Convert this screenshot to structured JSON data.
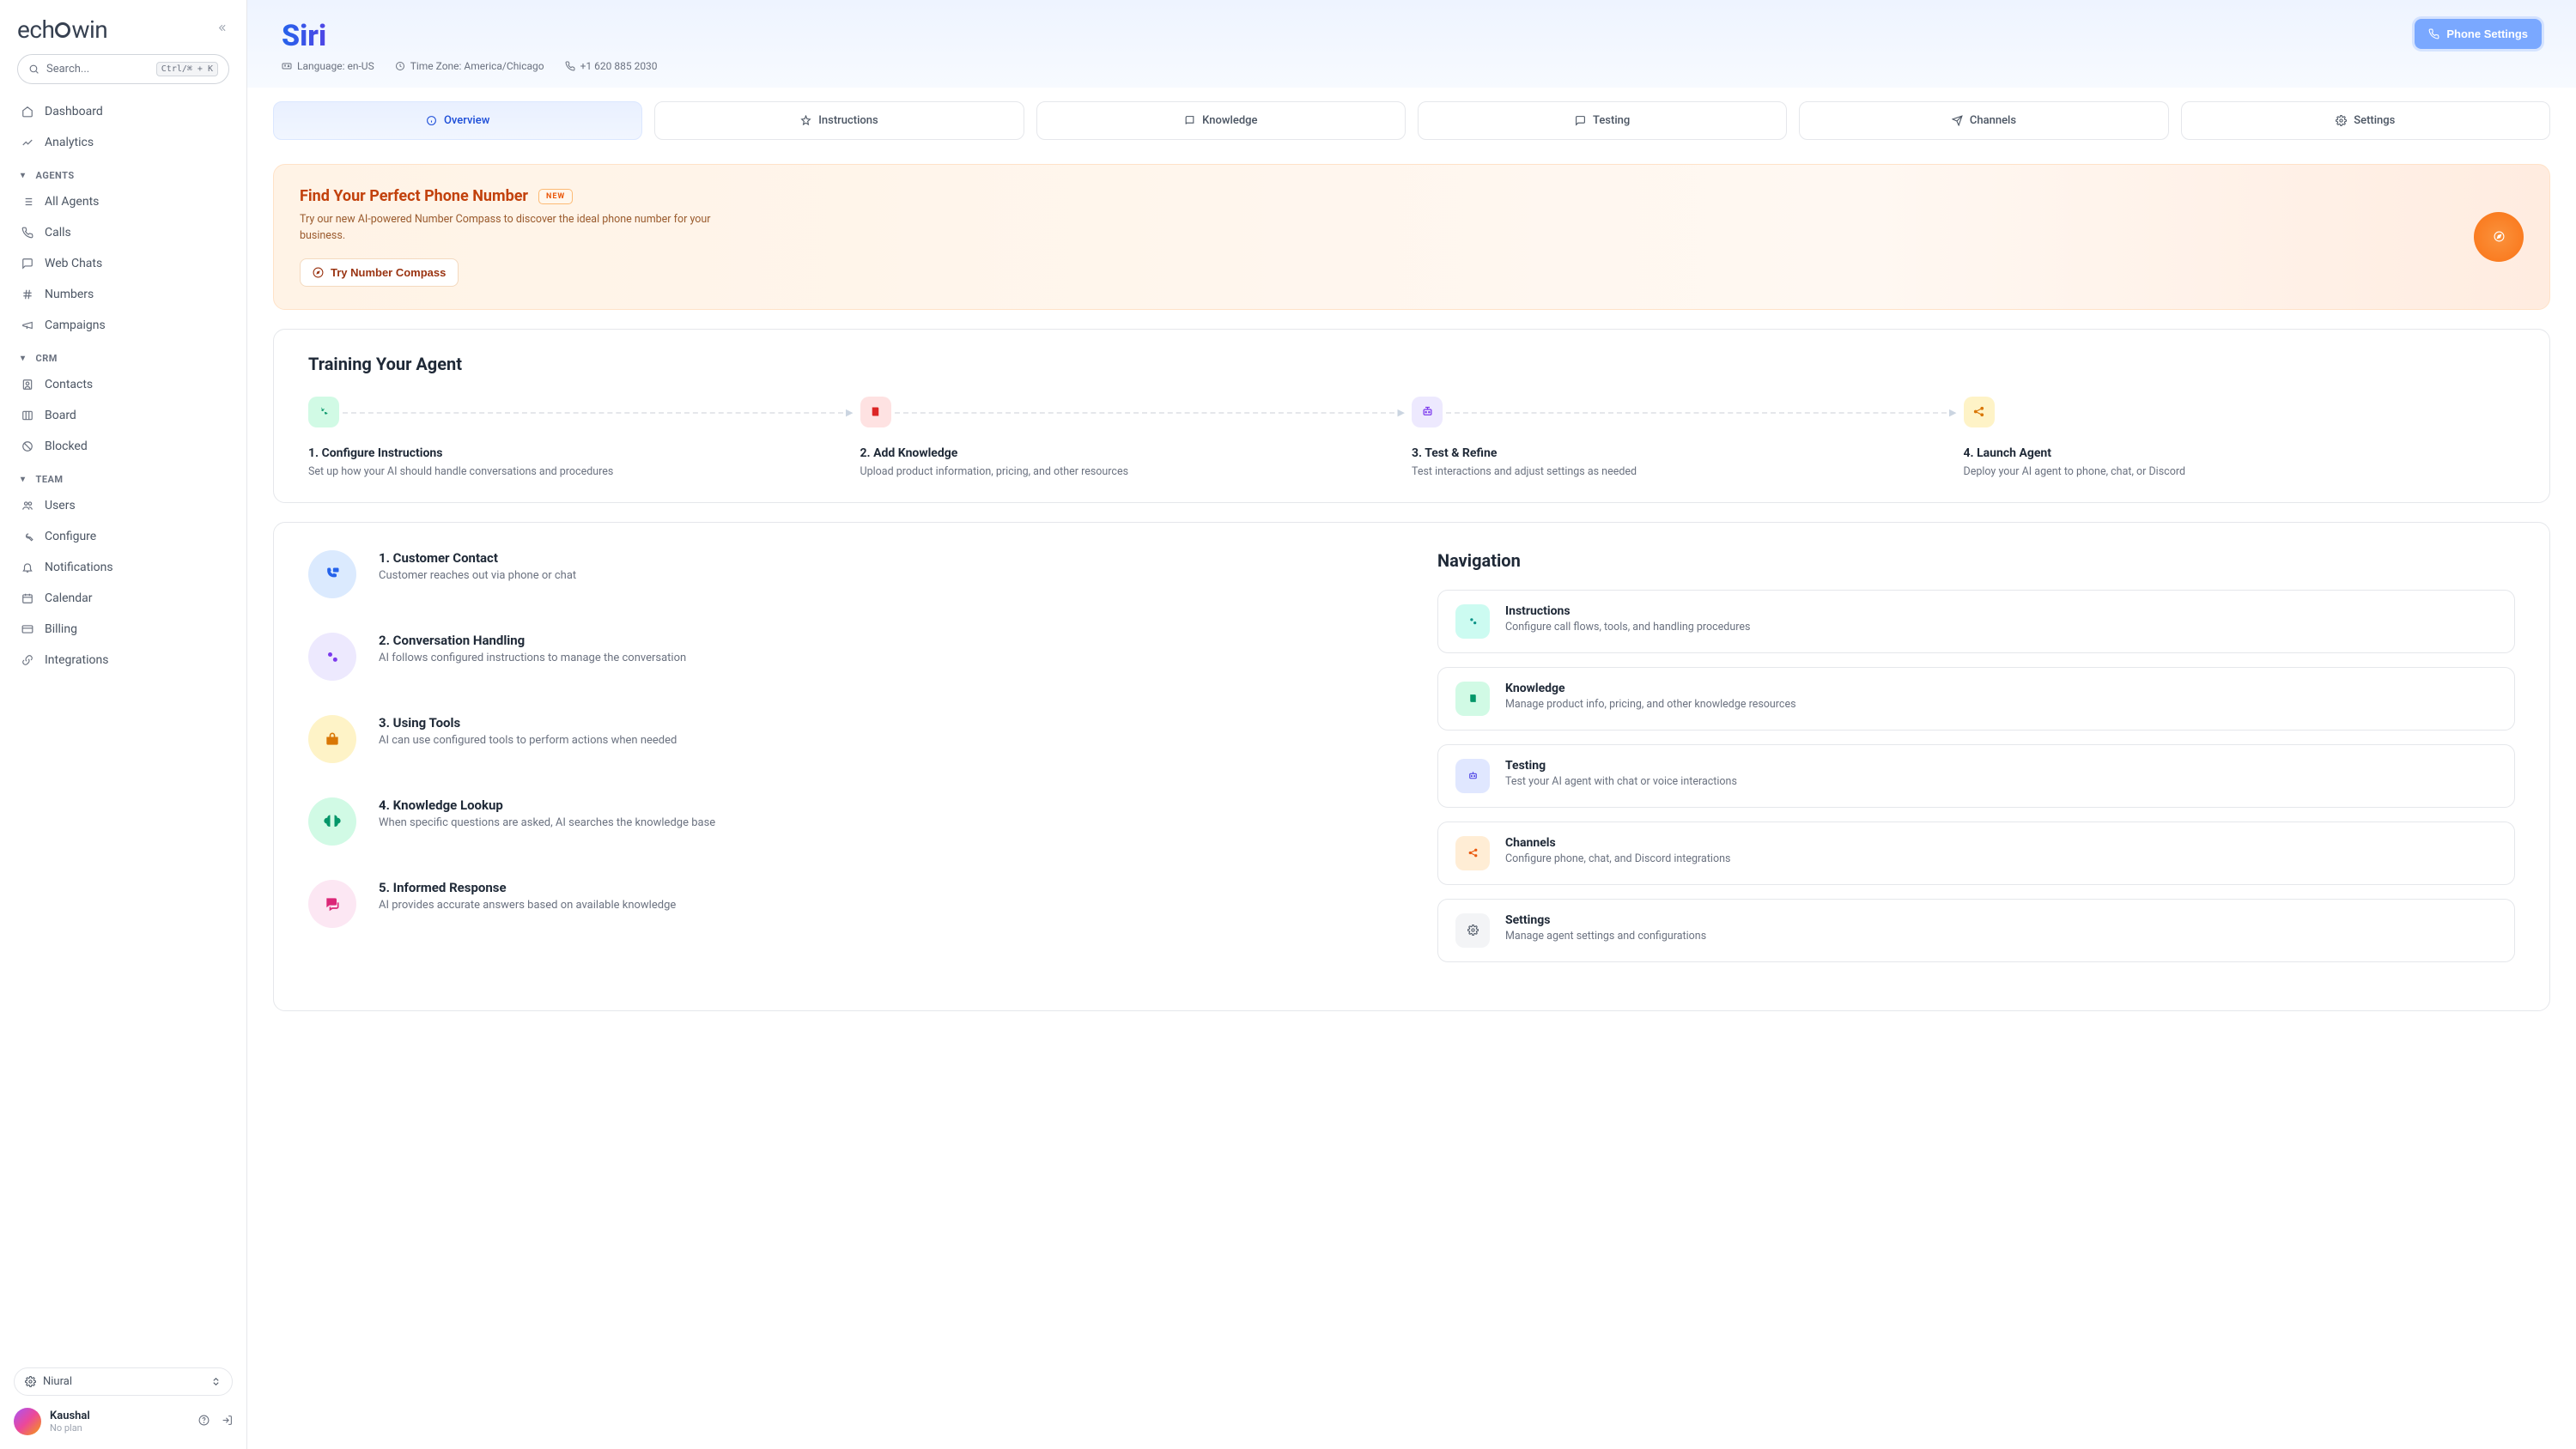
{
  "brand": {
    "name_left": "ech",
    "name_right": "win"
  },
  "search": {
    "placeholder": "Search...",
    "shortcut": "Ctrl/⌘ + K"
  },
  "sidebar": {
    "main": [
      {
        "label": "Dashboard"
      },
      {
        "label": "Analytics"
      }
    ],
    "groups": [
      {
        "label": "AGENTS",
        "items": [
          {
            "label": "All Agents"
          },
          {
            "label": "Calls"
          },
          {
            "label": "Web Chats"
          },
          {
            "label": "Numbers"
          },
          {
            "label": "Campaigns"
          }
        ]
      },
      {
        "label": "CRM",
        "items": [
          {
            "label": "Contacts"
          },
          {
            "label": "Board"
          },
          {
            "label": "Blocked"
          }
        ]
      },
      {
        "label": "TEAM",
        "items": [
          {
            "label": "Users"
          },
          {
            "label": "Configure"
          },
          {
            "label": "Notifications"
          },
          {
            "label": "Calendar"
          },
          {
            "label": "Billing"
          },
          {
            "label": "Integrations"
          }
        ]
      }
    ]
  },
  "org": {
    "name": "Niural"
  },
  "user": {
    "name": "Kaushal",
    "plan": "No plan"
  },
  "header": {
    "title": "Siri",
    "phone_settings_label": "Phone Settings",
    "language_label": "Language: en-US",
    "timezone_label": "Time Zone: America/Chicago",
    "phone_label": "+1 620 885 2030"
  },
  "tabs": [
    {
      "label": "Overview"
    },
    {
      "label": "Instructions"
    },
    {
      "label": "Knowledge"
    },
    {
      "label": "Testing"
    },
    {
      "label": "Channels"
    },
    {
      "label": "Settings"
    }
  ],
  "banner": {
    "title": "Find Your Perfect Phone Number",
    "badge": "NEW",
    "subtitle": "Try our new AI-powered Number Compass to discover the ideal phone number for your business.",
    "button_label": "Try Number Compass"
  },
  "training": {
    "title": "Training Your Agent",
    "steps": [
      {
        "title": "1. Configure Instructions",
        "desc": "Set up how your AI should handle conversations and procedures"
      },
      {
        "title": "2. Add Knowledge",
        "desc": "Upload product information, pricing, and other resources"
      },
      {
        "title": "3. Test & Refine",
        "desc": "Test interactions and adjust settings as needed"
      },
      {
        "title": "4. Launch Agent",
        "desc": "Deploy your AI agent to phone, chat, or Discord"
      }
    ]
  },
  "flow": [
    {
      "title": "1. Customer Contact",
      "desc": "Customer reaches out via phone or chat"
    },
    {
      "title": "2. Conversation Handling",
      "desc": "AI follows configured instructions to manage the conversation"
    },
    {
      "title": "3. Using Tools",
      "desc": "AI can use configured tools to perform actions when needed"
    },
    {
      "title": "4. Knowledge Lookup",
      "desc": "When specific questions are asked, AI searches the knowledge base"
    },
    {
      "title": "5. Informed Response",
      "desc": "AI provides accurate answers based on available knowledge"
    }
  ],
  "navigation": {
    "title": "Navigation",
    "cards": [
      {
        "title": "Instructions",
        "desc": "Configure call flows, tools, and handling procedures"
      },
      {
        "title": "Knowledge",
        "desc": "Manage product info, pricing, and other knowledge resources"
      },
      {
        "title": "Testing",
        "desc": "Test your AI agent with chat or voice interactions"
      },
      {
        "title": "Channels",
        "desc": "Configure phone, chat, and Discord integrations"
      },
      {
        "title": "Settings",
        "desc": "Manage agent settings and configurations"
      }
    ]
  }
}
